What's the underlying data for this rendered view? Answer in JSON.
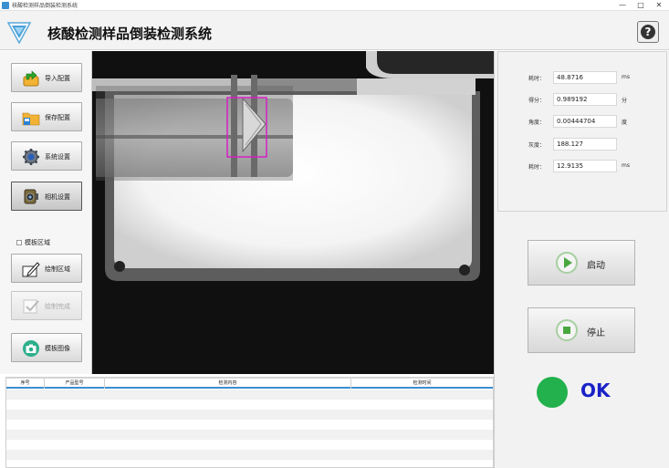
{
  "window": {
    "title": "核酸检测样品倒装检测系统",
    "minimize": "—",
    "maximize": "□",
    "close": "✕"
  },
  "header": {
    "title": "核酸检测样品倒装检测系统",
    "help_label": "?"
  },
  "sidebar": {
    "buttons": [
      {
        "label": "导入配置",
        "icon": "import-arrow-icon"
      },
      {
        "label": "保存配置",
        "icon": "save-folder-icon"
      },
      {
        "label": "系统设置",
        "icon": "gear-icon"
      },
      {
        "label": "相机设置",
        "icon": "camera-icon"
      }
    ],
    "roi_checkbox_label": "模板区域",
    "roi_buttons": [
      {
        "label": "绘制区域",
        "icon": "draw-pen-icon"
      },
      {
        "label": "绘制完成",
        "icon": "check-icon"
      },
      {
        "label": "模板图像",
        "icon": "camera-capture-icon"
      }
    ]
  },
  "params": [
    {
      "label": "耗时：",
      "value": "48.8716",
      "unit": "ms"
    },
    {
      "label": "得分：",
      "value": "0.989192",
      "unit": "分"
    },
    {
      "label": "角度：",
      "value": "0.00444704",
      "unit": "度"
    },
    {
      "label": "灰度：",
      "value": "188.127",
      "unit": ""
    },
    {
      "label": "耗时：",
      "value": "12.9135",
      "unit": "ms"
    }
  ],
  "controls": {
    "start_label": "启动",
    "stop_label": "停止"
  },
  "status": {
    "text": "OK",
    "color": "#22b14c"
  },
  "table": {
    "headers": [
      "序号",
      "产品型号",
      "检测内容",
      "检测时间"
    ]
  },
  "colors": {
    "accent": "#3a8fd0",
    "ok_text": "#1a22c8",
    "roi_box": "#d61fc5"
  }
}
